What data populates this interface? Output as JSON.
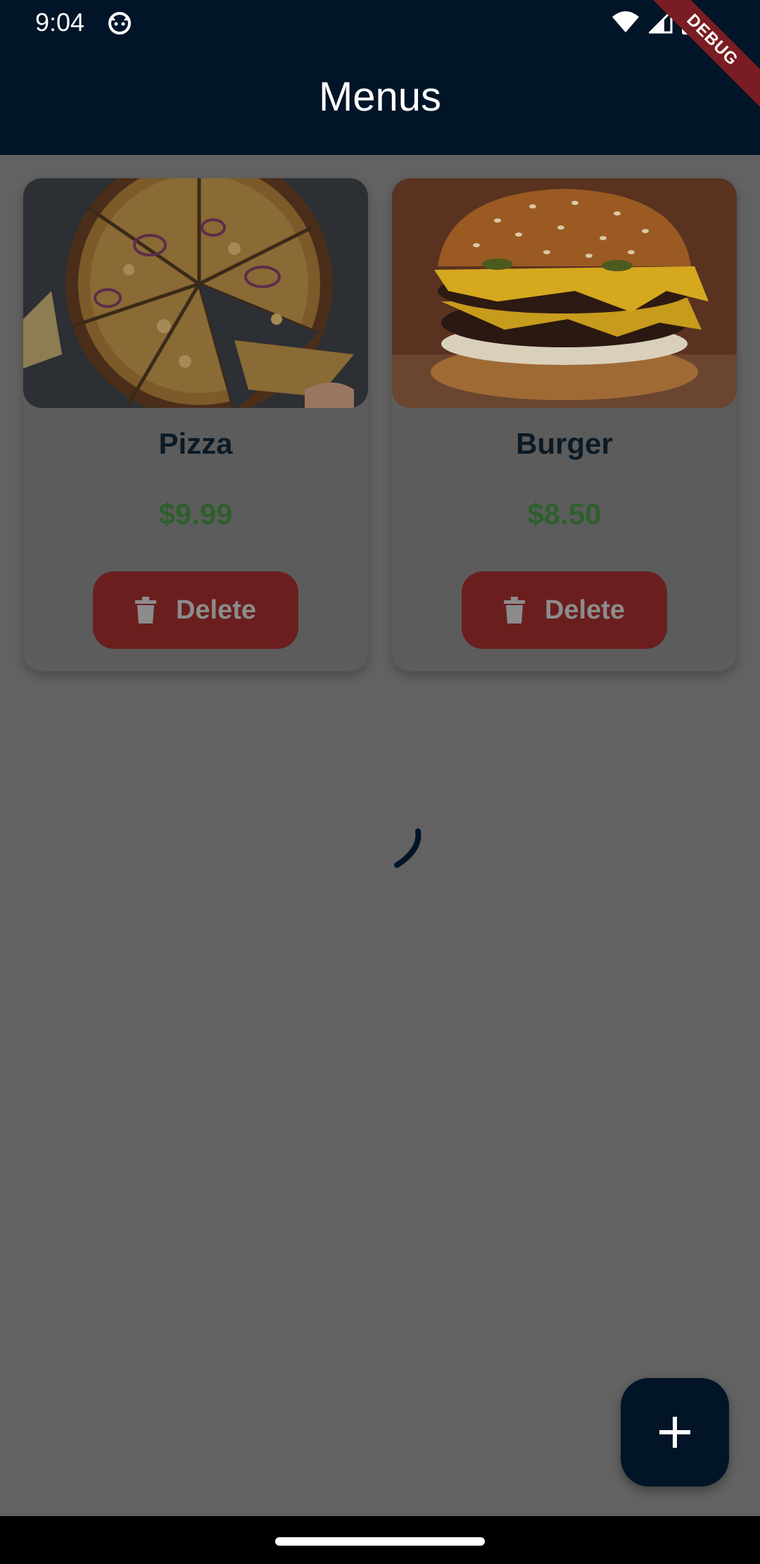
{
  "status_bar": {
    "time": "9:04",
    "icons": [
      "cat-icon",
      "wifi-icon",
      "signal-icon",
      "battery-icon"
    ]
  },
  "debug_banner": {
    "label": "DEBUG"
  },
  "app_bar": {
    "title": "Menus"
  },
  "menu_items": [
    {
      "name": "Pizza",
      "price": "$9.99",
      "delete_label": "Delete",
      "image": "pizza-photo"
    },
    {
      "name": "Burger",
      "price": "$8.50",
      "delete_label": "Delete",
      "image": "burger-photo"
    }
  ],
  "loading": {
    "visible": true
  },
  "fab": {
    "icon": "plus-icon"
  },
  "colors": {
    "app_bar": "#021427",
    "scrim_background": "#626262",
    "card": "#5c5c5c",
    "price": "#2e5f2c",
    "delete_button": "#6a1f1e",
    "fab": "#021427"
  }
}
